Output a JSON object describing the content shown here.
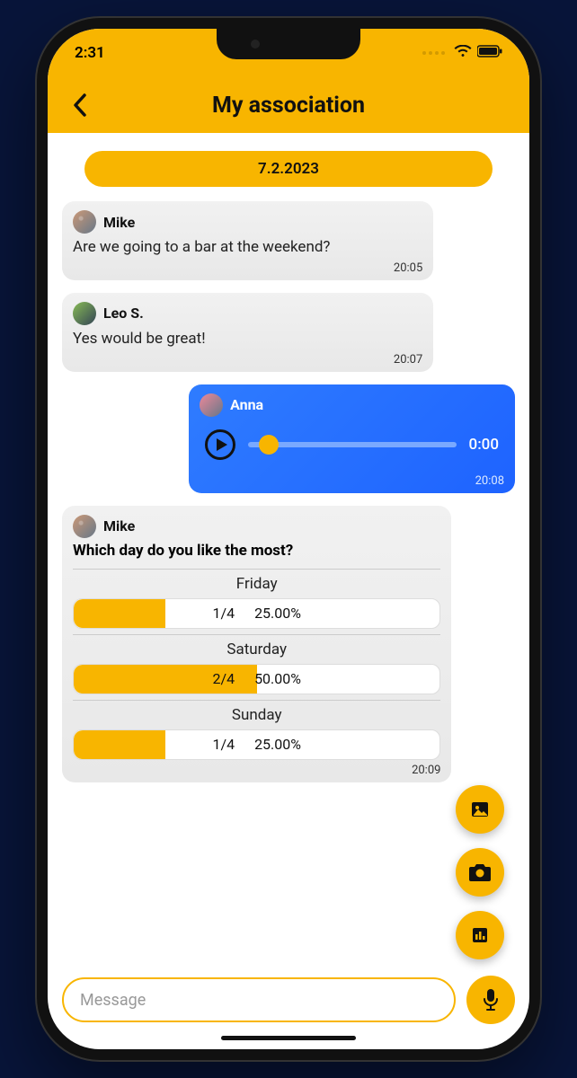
{
  "status": {
    "time": "2:31"
  },
  "header": {
    "title": "My association"
  },
  "date_pill": "7.2.2023",
  "messages": [
    {
      "sender": "Mike",
      "text": "Are we going to a bar at the weekend?",
      "time": "20:05"
    },
    {
      "sender": "Leo S.",
      "text": "Yes would be great!",
      "time": "20:07"
    }
  ],
  "audio_msg": {
    "sender": "Anna",
    "duration": "0:00",
    "time": "20:08"
  },
  "poll": {
    "sender": "Mike",
    "question": "Which day do you like the most?",
    "options": [
      {
        "label": "Friday",
        "count": "1/4",
        "pct_label": "25.00%",
        "pct": 25
      },
      {
        "label": "Saturday",
        "count": "2/4",
        "pct_label": "50.00%",
        "pct": 50
      },
      {
        "label": "Sunday",
        "count": "1/4",
        "pct_label": "25.00%",
        "pct": 25
      }
    ],
    "time": "20:09"
  },
  "input": {
    "placeholder": "Message"
  }
}
